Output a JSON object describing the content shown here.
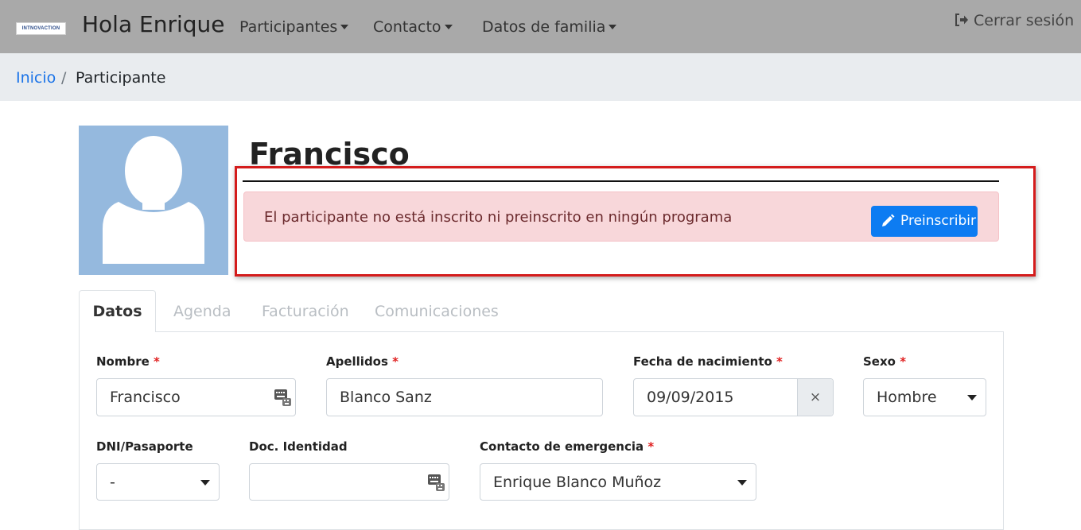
{
  "navbar": {
    "logo_text": "INTNOVACTION",
    "brand": "Hola Enrique",
    "items": [
      {
        "label": "Participantes"
      },
      {
        "label": "Contacto"
      },
      {
        "label": "Datos de familia"
      }
    ],
    "logout": {
      "label": "Cerrar sesión",
      "icon": "sign-out-icon"
    }
  },
  "breadcrumb": {
    "home": "Inicio",
    "separator": "/",
    "current": "Participante"
  },
  "profile": {
    "name": "Francisco",
    "alert_text": "El participante no está inscrito ni preinscrito en ningún programa",
    "preinscribir_label": "Preinscribir"
  },
  "tabs": [
    {
      "label": "Datos",
      "active": true
    },
    {
      "label": "Agenda",
      "active": false
    },
    {
      "label": "Facturación",
      "active": false
    },
    {
      "label": "Comunicaciones",
      "active": false
    }
  ],
  "form": {
    "required_mark": "*",
    "nombre": {
      "label": "Nombre",
      "value": "Francisco"
    },
    "apellidos": {
      "label": "Apellidos",
      "value": "Blanco Sanz"
    },
    "fecha": {
      "label": "Fecha de nacimiento",
      "value": "09/09/2015",
      "clear": "×"
    },
    "sexo": {
      "label": "Sexo",
      "value": "Hombre"
    },
    "dni": {
      "label": "DNI/Pasaporte",
      "value": "-"
    },
    "doc": {
      "label": "Doc. Identidad",
      "value": ""
    },
    "contacto": {
      "label": "Contacto de emergencia",
      "value": "Enrique Blanco Muñoz"
    }
  },
  "colors": {
    "navbar": "#a9a9a9",
    "breadcrumb_bg": "#e9ecef",
    "link": "#1a73e8",
    "alert_bg": "#f8d7da",
    "button": "#0d7cf2",
    "highlight_border": "#d41c1c",
    "avatar_bg": "#95b9de"
  }
}
